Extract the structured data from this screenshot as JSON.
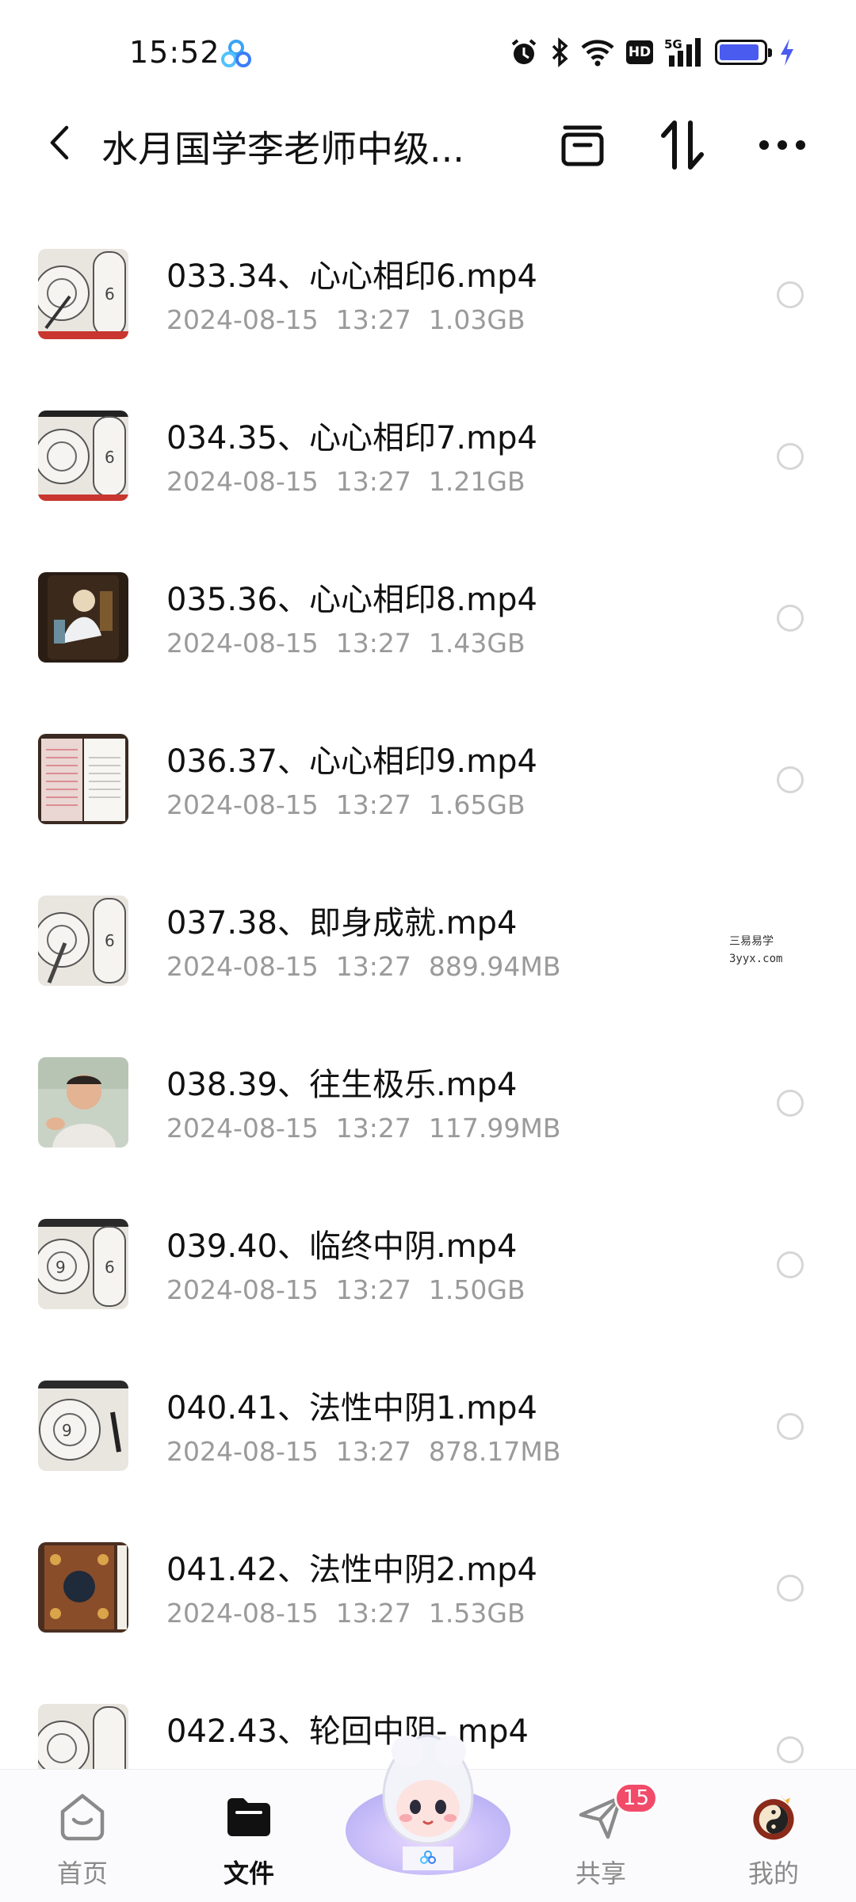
{
  "status_bar": {
    "time": "15:52",
    "network": "5G",
    "hd_label": "HD",
    "icons": [
      "alarm-icon",
      "bluetooth-icon",
      "wifi-icon",
      "hd-icon",
      "signal-5g-icon",
      "battery-icon",
      "charging-icon"
    ],
    "battery_level": 0.9
  },
  "header": {
    "title": "水月国学李老师中级...",
    "actions": [
      "back-icon",
      "archive-icon",
      "sort-icon",
      "more-icon"
    ]
  },
  "files": [
    {
      "name": "033.34、心心相印6.mp4",
      "date": "2024-08-15",
      "time": "13:27",
      "size": "1.03GB",
      "thumb": "chart"
    },
    {
      "name": "034.35、心心相印7.mp4",
      "date": "2024-08-15",
      "time": "13:27",
      "size": "1.21GB",
      "thumb": "chart"
    },
    {
      "name": "035.36、心心相印8.mp4",
      "date": "2024-08-15",
      "time": "13:27",
      "size": "1.43GB",
      "thumb": "painting"
    },
    {
      "name": "036.37、心心相印9.mp4",
      "date": "2024-08-15",
      "time": "13:27",
      "size": "1.65GB",
      "thumb": "book"
    },
    {
      "name": "037.38、即身成就.mp4",
      "date": "2024-08-15",
      "time": "13:27",
      "size": "889.94MB",
      "thumb": "chart"
    },
    {
      "name": "038.39、往生极乐.mp4",
      "date": "2024-08-15",
      "time": "13:27",
      "size": "117.99MB",
      "thumb": "person"
    },
    {
      "name": "039.40、临终中阴.mp4",
      "date": "2024-08-15",
      "time": "13:27",
      "size": "1.50GB",
      "thumb": "chart"
    },
    {
      "name": "040.41、法性中阴1.mp4",
      "date": "2024-08-15",
      "time": "13:27",
      "size": "878.17MB",
      "thumb": "chart"
    },
    {
      "name": "041.42、法性中阴2.mp4",
      "date": "2024-08-15",
      "time": "13:27",
      "size": "1.53GB",
      "thumb": "thangka"
    },
    {
      "name": "042.43、轮回中阴- mp4",
      "date": "",
      "time": "",
      "size": "",
      "thumb": "chart"
    }
  ],
  "watermark": {
    "line1": "三易易学",
    "line2": "3yyx.com"
  },
  "bottom_nav": {
    "items": [
      {
        "label": "首页",
        "icon": "home-icon",
        "active": false
      },
      {
        "label": "文件",
        "icon": "folder-icon",
        "active": true
      },
      {
        "label": "共享",
        "icon": "send-icon",
        "active": false,
        "badge": "15"
      },
      {
        "label": "我的",
        "icon": "avatar-icon",
        "active": false
      }
    ]
  },
  "colors": {
    "accent": "#4a5cf0",
    "badge": "#f24b6a",
    "meta_text": "#9a9a9a"
  }
}
